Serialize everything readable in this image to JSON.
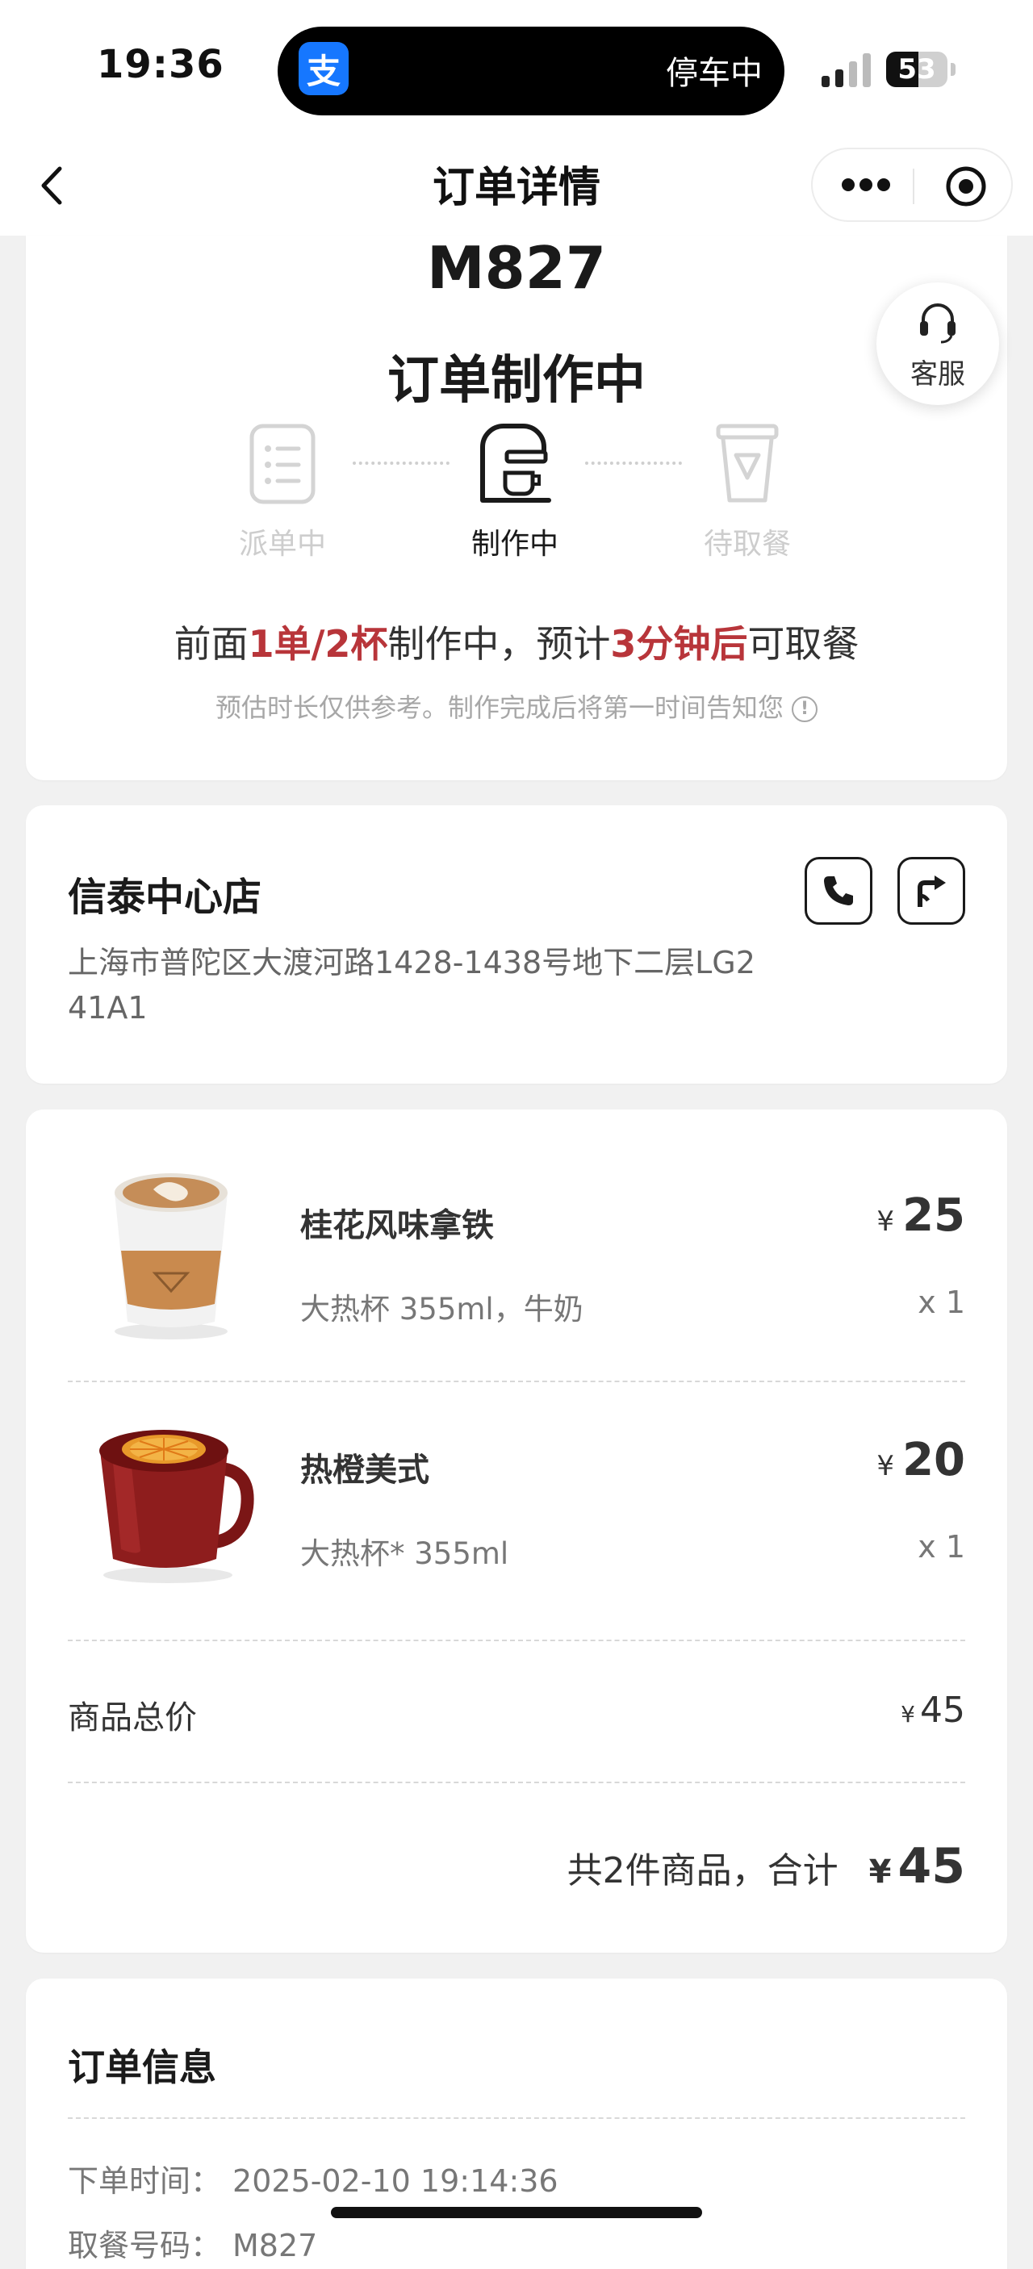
{
  "status_bar": {
    "time": "19:36",
    "app_badge": "支",
    "island_text": "停车中",
    "battery": "53",
    "battery_level": 0.53
  },
  "nav": {
    "title": "订单详情"
  },
  "order": {
    "number": "M827",
    "status": "订单制作中",
    "service_label": "客服",
    "steps": [
      {
        "label": "派单中",
        "active": false
      },
      {
        "label": "制作中",
        "active": true
      },
      {
        "label": "待取餐",
        "active": false
      }
    ],
    "eta": {
      "p1": "前面",
      "h1": "1单/2杯",
      "p2": "制作中，预计",
      "h2": "3分钟后",
      "p3": "可取餐"
    },
    "note": "预估时长仅供参考。制作完成后将第一时间告知您",
    "highlight_color": "#b8353a"
  },
  "store": {
    "name": "信泰中心店",
    "address": "上海市普陀区大渡河路1428-1438号地下二层LG2 41A1"
  },
  "items": [
    {
      "name": "桂花风味拿铁",
      "spec": "大热杯 355ml，牛奶",
      "currency": "¥",
      "price": "25",
      "qty": "x 1"
    },
    {
      "name": "热橙美式",
      "spec": "大热杯* 355ml",
      "currency": "¥",
      "price": "20",
      "qty": "x 1"
    }
  ],
  "summary": {
    "subtotal_label": "商品总价",
    "subtotal_currency": "¥",
    "subtotal_value": "45",
    "total_text": "共2件商品，合计",
    "total_currency": "¥",
    "total_value": "45"
  },
  "order_info": {
    "title": "订单信息",
    "rows": [
      {
        "label": "下单时间：",
        "value": "2025-02-10 19:14:36"
      },
      {
        "label": "取餐号码：",
        "value": "M827"
      }
    ]
  }
}
